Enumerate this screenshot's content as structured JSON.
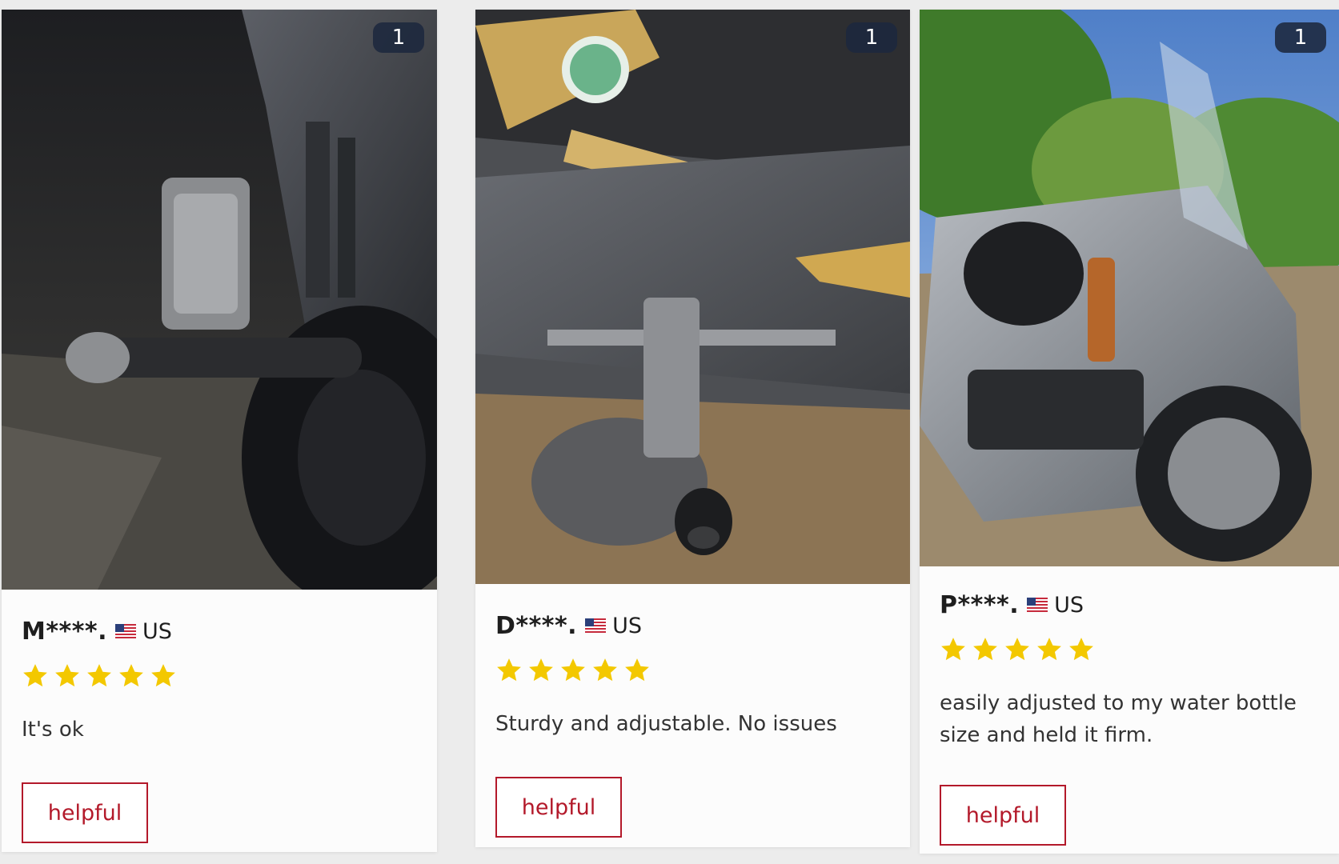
{
  "reviews": [
    {
      "photo_description": "motorcycle-crash-bar-bottle-holder-photo",
      "photo_count": "1",
      "reviewer_name": "M****.",
      "country": "US",
      "rating": 5,
      "text": "It's ok",
      "helpful_label": "helpful"
    },
    {
      "photo_description": "motorcycle-frame-bottle-holder-photo",
      "photo_count": "1",
      "reviewer_name": "D****.",
      "country": "US",
      "rating": 5,
      "text": "Sturdy and adjustable. No issues",
      "helpful_label": "helpful"
    },
    {
      "photo_description": "scooter-bottle-holder-photo",
      "photo_count": "1",
      "reviewer_name": "P****.",
      "country": "US",
      "rating": 5,
      "text": "easily adjusted to my water bottle size and held it firm.",
      "helpful_label": "helpful"
    }
  ],
  "colors": {
    "star": "#f3c800",
    "accent": "#b3192a",
    "badge": "#1c283e"
  },
  "icons": {
    "flag": "us-flag-icon",
    "star": "star-icon"
  }
}
